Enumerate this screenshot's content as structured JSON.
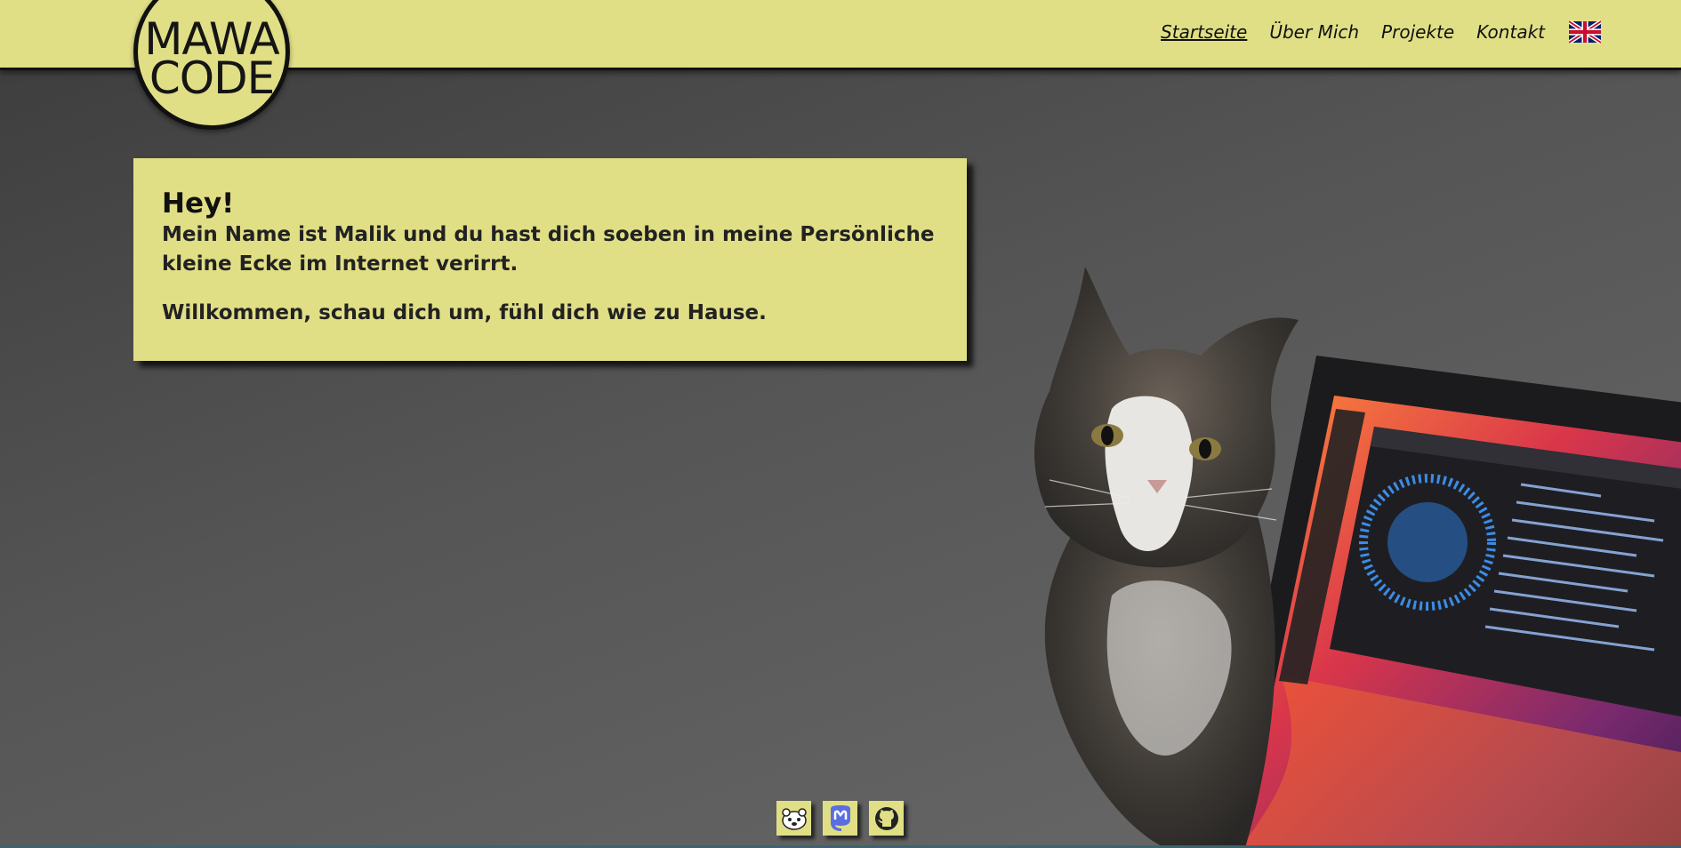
{
  "logo": {
    "line1": "MAWA",
    "line2": "CODE"
  },
  "nav": {
    "items": [
      {
        "label": "Startseite"
      },
      {
        "label": "Über Mich"
      },
      {
        "label": "Projekte"
      },
      {
        "label": "Kontakt"
      }
    ],
    "language_icon": "uk-flag-icon"
  },
  "intro": {
    "heading": "Hey!",
    "line1": "Mein Name ist Malik und du hast dich soeben in meine Persönliche kleine Ecke im Internet verirrt.",
    "line2": "Willkommen, schau dich um, fühl dich wie zu Hause."
  },
  "socials": [
    {
      "icon": "bear-icon"
    },
    {
      "icon": "mastodon-icon"
    },
    {
      "icon": "github-icon"
    }
  ],
  "colors": {
    "accent": "#e1df86",
    "background": "#555555",
    "text": "#1a1a1a"
  }
}
